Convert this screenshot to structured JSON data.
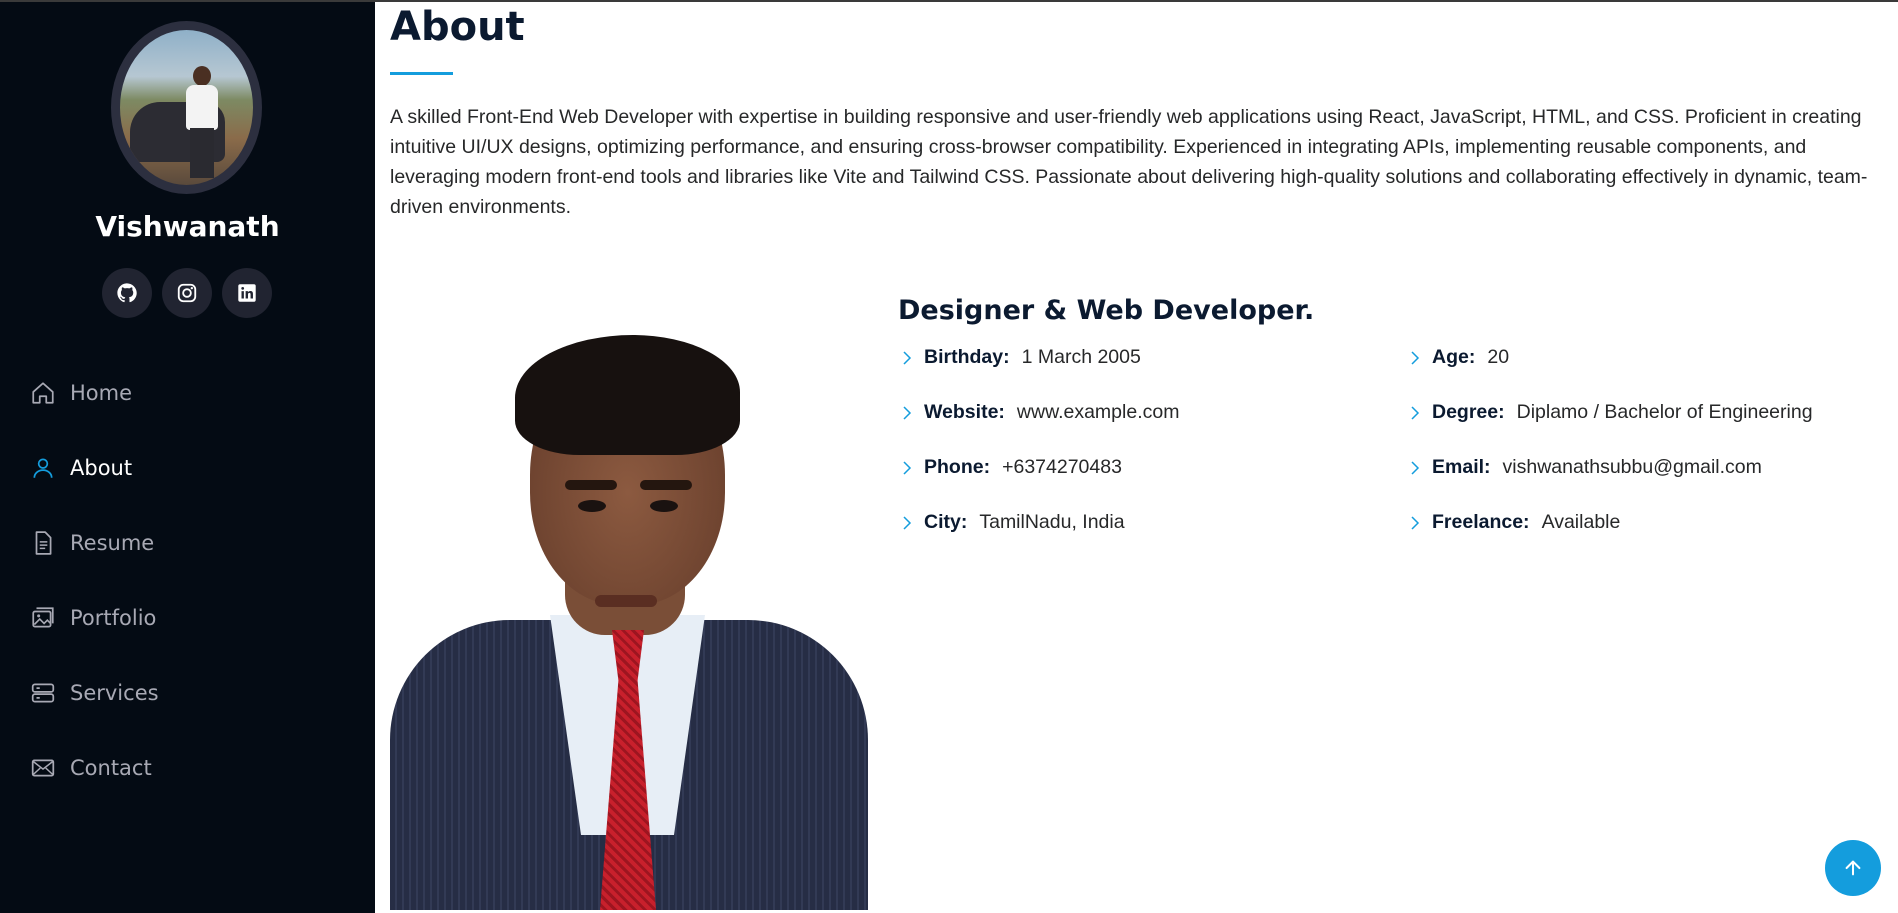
{
  "sidebar": {
    "profile_name": "Vishwanath",
    "socials": [
      {
        "name": "github-icon"
      },
      {
        "name": "instagram-icon"
      },
      {
        "name": "linkedin-icon"
      }
    ],
    "nav": [
      {
        "label": "Home",
        "icon": "home-icon",
        "active": false
      },
      {
        "label": "About",
        "icon": "person-icon",
        "active": true
      },
      {
        "label": "Resume",
        "icon": "file-icon",
        "active": false
      },
      {
        "label": "Portfolio",
        "icon": "images-icon",
        "active": false
      },
      {
        "label": "Services",
        "icon": "server-icon",
        "active": false
      },
      {
        "label": "Contact",
        "icon": "envelope-icon",
        "active": false
      }
    ]
  },
  "about": {
    "title": "About",
    "intro": "A skilled Front-End Web Developer with expertise in building responsive and user-friendly web applications using React, JavaScript, HTML, and CSS. Proficient in creating intuitive UI/UX designs, optimizing performance, and ensuring cross-browser compatibility. Experienced in integrating APIs, implementing reusable components, and leveraging modern front-end tools and libraries like Vite and Tailwind CSS. Passionate about delivering high-quality solutions and collaborating effectively in dynamic, team-driven environments.",
    "role": "Designer & Web Developer.",
    "details_left": [
      {
        "label": "Birthday:",
        "value": "1 March 2005"
      },
      {
        "label": "Website:",
        "value": "www.example.com"
      },
      {
        "label": "Phone:",
        "value": "+6374270483"
      },
      {
        "label": "City:",
        "value": "TamilNadu, India"
      }
    ],
    "details_right": [
      {
        "label": "Age:",
        "value": "20"
      },
      {
        "label": "Degree:",
        "value": "Diplamo / Bachelor of Engineering"
      },
      {
        "label": "Email:",
        "value": "vishwanathsubbu@gmail.com"
      },
      {
        "label": "Freelance:",
        "value": "Available"
      }
    ]
  },
  "colors": {
    "sidebar_bg": "#040b14",
    "accent": "#149ddd",
    "heading": "#0b1a30"
  }
}
